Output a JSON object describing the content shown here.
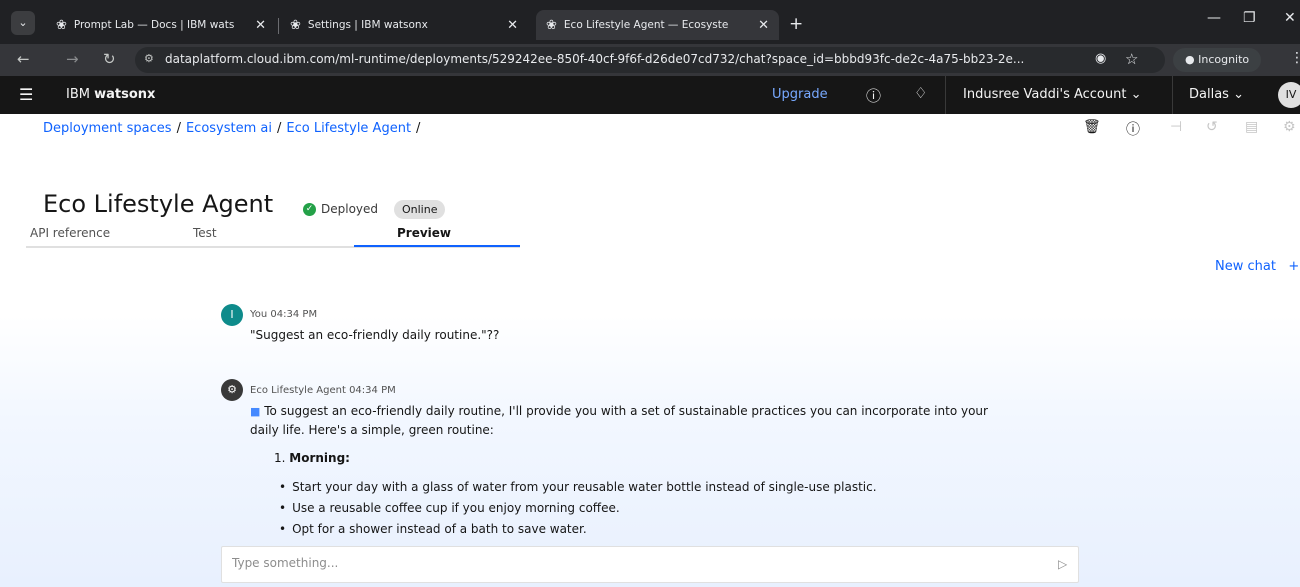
{
  "browser": {
    "tabs": [
      {
        "title": "Prompt Lab — Docs | IBM wats",
        "active": false
      },
      {
        "title": "Settings | IBM watsonx",
        "active": false
      },
      {
        "title": "Eco Lifestyle Agent — Ecosyste",
        "active": true
      }
    ],
    "url": "dataplatform.cloud.ibm.com/ml-runtime/deployments/529242ee-850f-40cf-9f6f-d26de07cd732/chat?space_id=bbbd93fc-de2c-4a75-bb23-2e...",
    "incognito_label": "Incognito"
  },
  "header": {
    "brand_prefix": "IBM",
    "brand_name": "watsonx",
    "upgrade": "Upgrade",
    "account": "Indusree Vaddi's Account",
    "region": "Dallas",
    "avatar_initials": "IV"
  },
  "breadcrumb": [
    "Deployment spaces",
    "Ecosystem ai",
    "Eco Lifestyle Agent"
  ],
  "page": {
    "title": "Eco Lifestyle Agent",
    "status": "Deployed",
    "badge": "Online"
  },
  "tabs": [
    {
      "label": "API reference"
    },
    {
      "label": "Test"
    },
    {
      "label": "Preview"
    }
  ],
  "new_chat": "New chat",
  "messages": {
    "user": {
      "avatar": "I",
      "meta": "You 04:34 PM",
      "text": "\"Suggest an eco-friendly daily routine.\"??"
    },
    "agent": {
      "meta": "Eco Lifestyle Agent 04:34 PM",
      "intro_line1": "To suggest an eco-friendly daily routine, I'll provide you with a set of sustainable practices you can incorporate into your",
      "intro_line2": "daily life. Here's a simple, green routine:",
      "section_number": "1.",
      "section_title": "Morning:",
      "bullets": [
        "Start your day with a glass of water from your reusable water bottle instead of single-use plastic.",
        "Use a reusable coffee cup if you enjoy morning coffee.",
        "Opt for a shower instead of a bath to save water."
      ]
    }
  },
  "input": {
    "placeholder": "Type something..."
  },
  "colors": {
    "accent": "#0f62fe",
    "header_bg": "#161616",
    "deployed_green": "#24a148",
    "user_avatar": "#0e8b8b"
  }
}
